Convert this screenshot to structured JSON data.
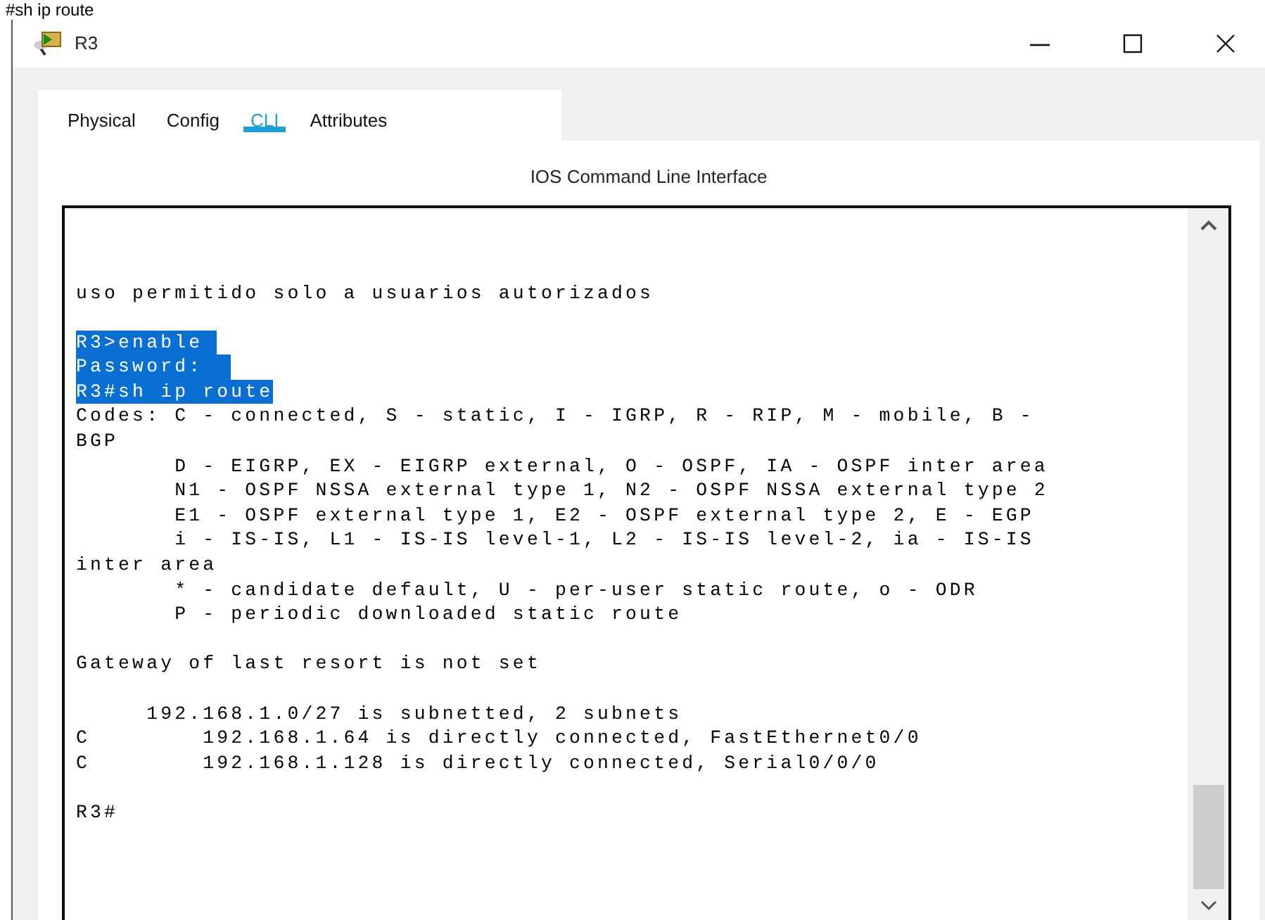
{
  "caption": "#sh ip route",
  "window": {
    "title": "R3"
  },
  "tabs": [
    {
      "label": "Physical",
      "selected": false
    },
    {
      "label": "Config",
      "selected": false
    },
    {
      "label": "CLI",
      "selected": true
    },
    {
      "label": "Attributes",
      "selected": false
    }
  ],
  "panel_title": "IOS Command Line Interface",
  "terminal": {
    "blocks": [
      [
        {
          "text": "uso permitido solo a usuarios autorizados",
          "highlighted": false
        }
      ],
      [
        {
          "text": "R3>enable ",
          "highlighted": true
        },
        {
          "text": "Password:  ",
          "highlighted": true
        },
        {
          "text": "R3#sh ip route",
          "highlighted": true
        },
        {
          "text": "Codes: C - connected, S - static, I - IGRP, R - RIP, M - mobile, B -",
          "highlighted": false
        },
        {
          "text": "BGP",
          "highlighted": false
        },
        {
          "text": "       D - EIGRP, EX - EIGRP external, O - OSPF, IA - OSPF inter area",
          "highlighted": false
        },
        {
          "text": "       N1 - OSPF NSSA external type 1, N2 - OSPF NSSA external type 2",
          "highlighted": false
        },
        {
          "text": "       E1 - OSPF external type 1, E2 - OSPF external type 2, E - EGP",
          "highlighted": false
        },
        {
          "text": "       i - IS-IS, L1 - IS-IS level-1, L2 - IS-IS level-2, ia - IS-IS",
          "highlighted": false
        },
        {
          "text": "inter area",
          "highlighted": false
        },
        {
          "text": "       * - candidate default, U - per-user static route, o - ODR",
          "highlighted": false
        },
        {
          "text": "       P - periodic downloaded static route",
          "highlighted": false
        }
      ],
      [
        {
          "text": "Gateway of last resort is not set",
          "highlighted": false
        }
      ],
      [
        {
          "text": "     192.168.1.0/27 is subnetted, 2 subnets",
          "highlighted": false
        },
        {
          "text": "C        192.168.1.64 is directly connected, FastEthernet0/0",
          "highlighted": false
        },
        {
          "text": "C        192.168.1.128 is directly connected, Serial0/0/0",
          "highlighted": false
        }
      ],
      [
        {
          "text": "R3#",
          "highlighted": false
        }
      ]
    ]
  }
}
